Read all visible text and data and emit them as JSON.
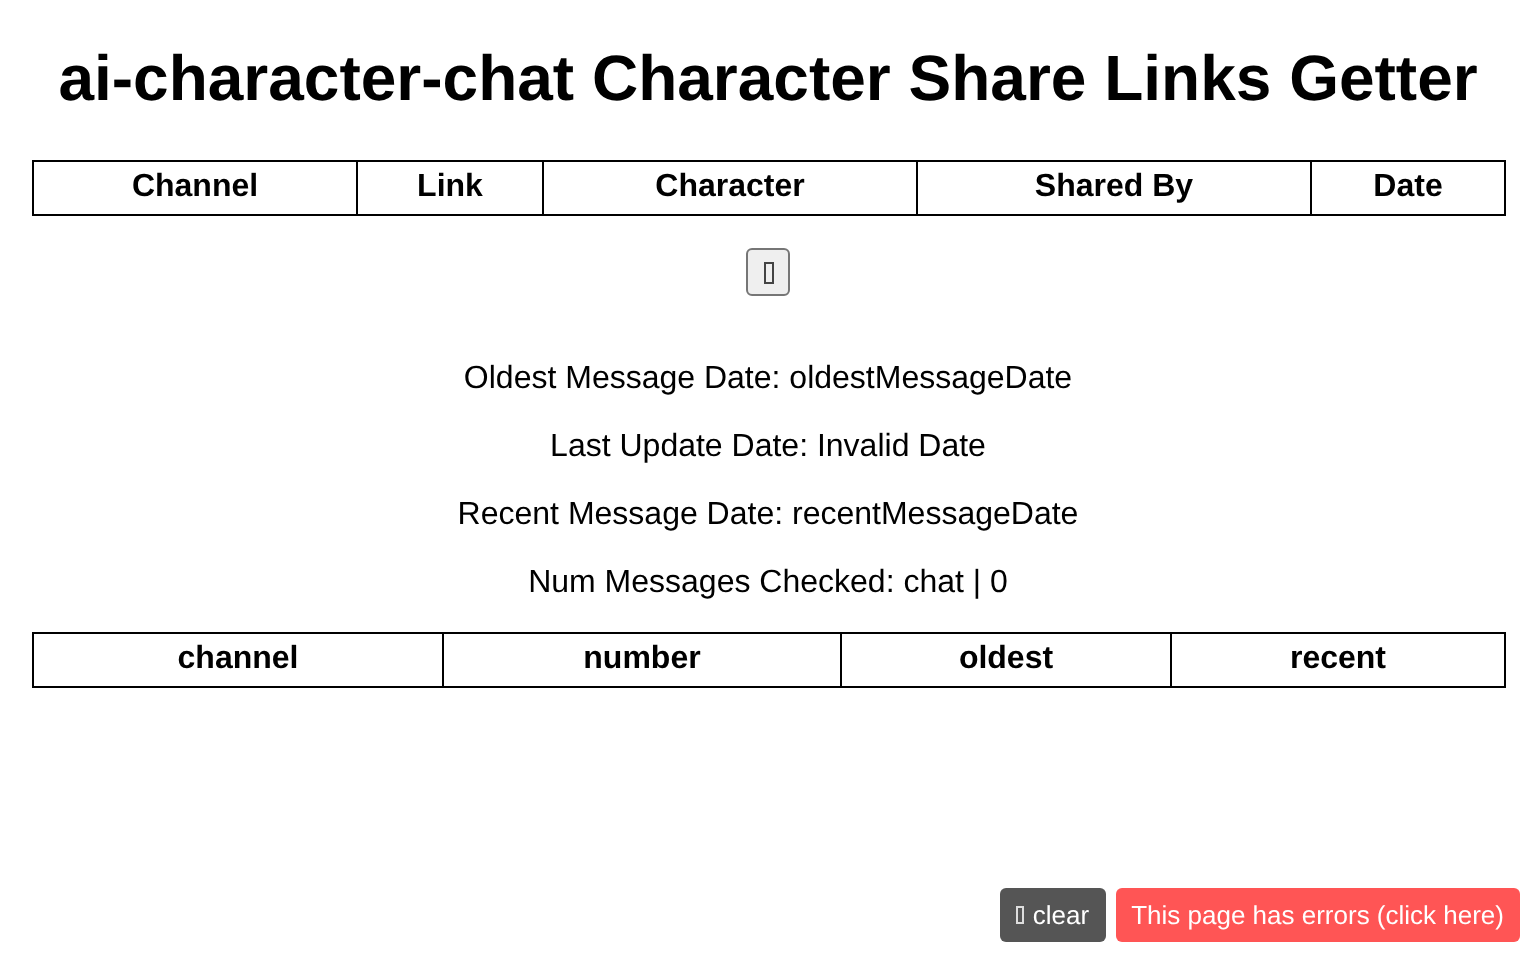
{
  "title": "ai-character-chat Character Share Links Getter",
  "links_table": {
    "columns": [
      "Channel",
      "Link",
      "Character",
      "Shared By",
      "Date"
    ]
  },
  "info_lines": [
    "Oldest Message Date: oldestMessageDate",
    "Last Update Date: Invalid Date",
    "Recent Message Date: recentMessageDate",
    "Num Messages Checked: chat | 0"
  ],
  "channels_table": {
    "columns": [
      "channel",
      "number",
      "oldest",
      "recent"
    ]
  },
  "error_bar": {
    "clear_label": "clear",
    "errors_label": "This page has errors (click here)"
  }
}
